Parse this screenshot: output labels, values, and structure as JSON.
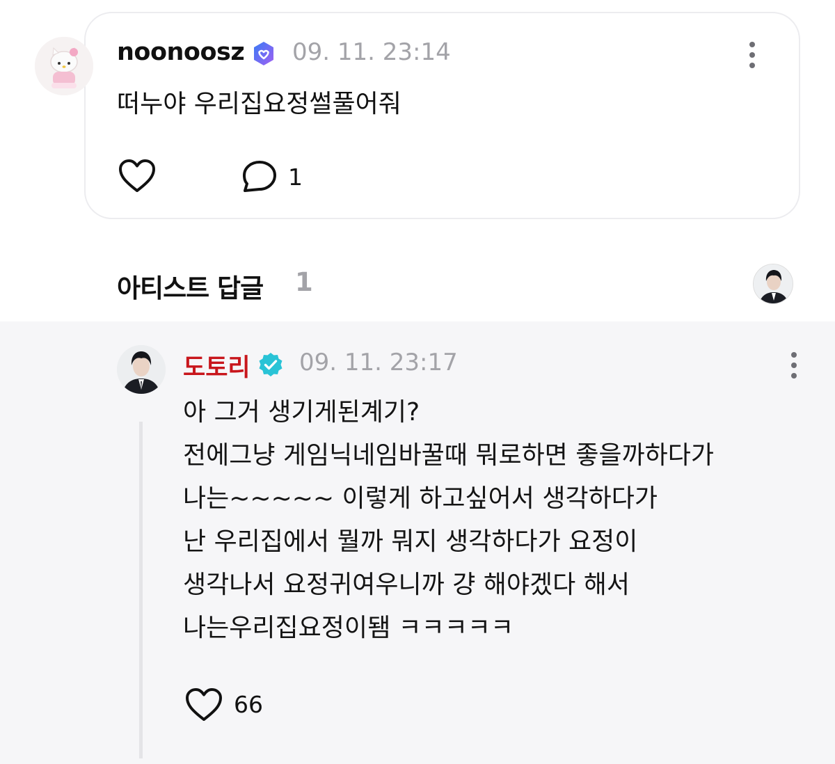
{
  "fan_comment": {
    "username": "noonoosz",
    "timestamp": "09. 11. 23:14",
    "text": "떠누야 우리집요정썰풀어줘",
    "reply_count": "1",
    "avatar_icon": "hello-kitty-avatar-icon",
    "badge_icon": "fan-verified-badge-icon"
  },
  "section": {
    "title": "아티스트 답글",
    "count": "1"
  },
  "artist_reply": {
    "username": "도토리",
    "timestamp": "09. 11. 23:17",
    "lines": [
      "아 그거 생기게된계기?",
      "전에그냥 게임닉네임바꿀때 뭐로하면 좋을까하다가",
      "나는~~~~~ 이렇게 하고싶어서 생각하다가",
      "난 우리집에서 뭘까 뭐지 생각하다가 요정이",
      "생각나서 요정귀여우니까 걍 해야겠다 해서",
      "나는우리집요정이됌 ㅋㅋㅋㅋㅋ"
    ],
    "like_count": "66",
    "badge_icon": "artist-verified-badge-icon"
  },
  "colors": {
    "artist_name": "#c8161c",
    "timestamp": "#a3a3a8",
    "reply_background": "#f6f6f8",
    "artist_badge": "#29c3d6"
  }
}
